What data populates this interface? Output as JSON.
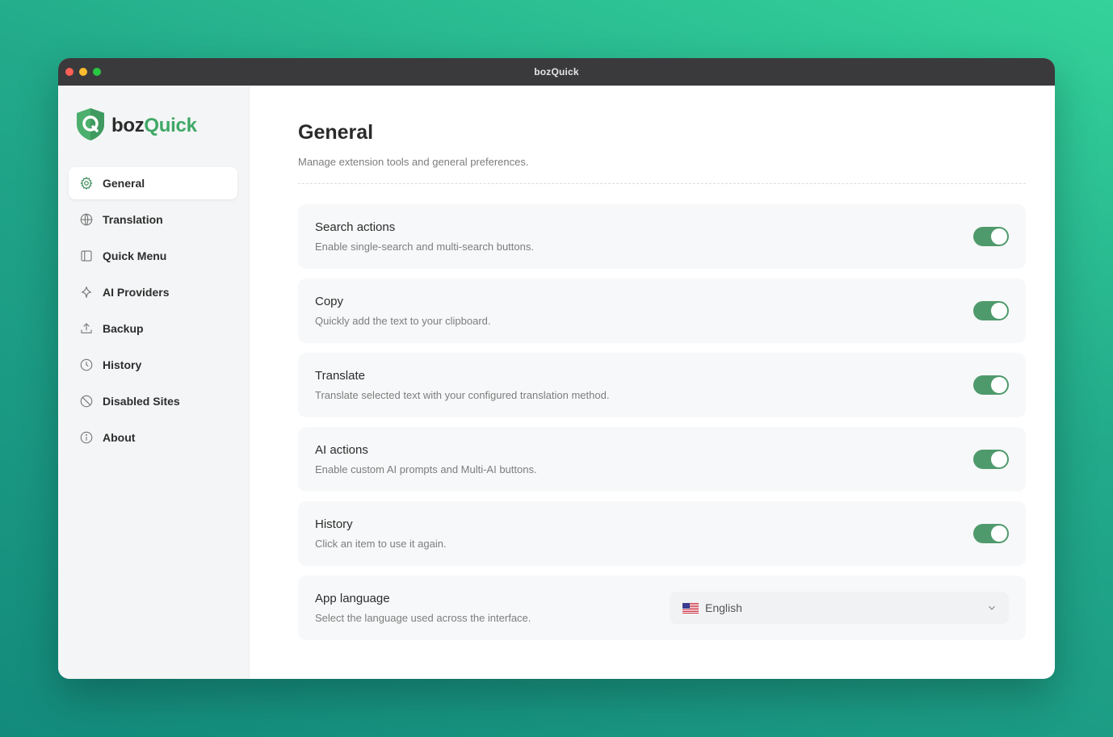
{
  "window": {
    "title": "bozQuick"
  },
  "brand": {
    "part1": "boz",
    "part2": "Quick"
  },
  "sidebar": {
    "items": [
      {
        "label": "General",
        "icon": "gear-icon",
        "active": true
      },
      {
        "label": "Translation",
        "icon": "globe-icon",
        "active": false
      },
      {
        "label": "Quick Menu",
        "icon": "panel-icon",
        "active": false
      },
      {
        "label": "AI Providers",
        "icon": "sparkle-icon",
        "active": false
      },
      {
        "label": "Backup",
        "icon": "upload-icon",
        "active": false
      },
      {
        "label": "History",
        "icon": "clock-icon",
        "active": false
      },
      {
        "label": "Disabled Sites",
        "icon": "ban-icon",
        "active": false
      },
      {
        "label": "About",
        "icon": "info-icon",
        "active": false
      }
    ]
  },
  "main": {
    "title": "General",
    "subtitle": "Manage extension tools and general preferences.",
    "settings": [
      {
        "title": "Search actions",
        "desc": "Enable single-search and multi-search buttons.",
        "enabled": true
      },
      {
        "title": "Copy",
        "desc": "Quickly add the text to your clipboard.",
        "enabled": true
      },
      {
        "title": "Translate",
        "desc": "Translate selected text with your configured translation method.",
        "enabled": true
      },
      {
        "title": "AI actions",
        "desc": "Enable custom AI prompts and Multi-AI buttons.",
        "enabled": true
      },
      {
        "title": "History",
        "desc": "Click an item to use it again.",
        "enabled": true
      }
    ],
    "language": {
      "title": "App language",
      "desc": "Select the language used across the interface.",
      "selected": "English",
      "flag_icon": "us-flag-icon"
    }
  },
  "colors": {
    "accent": "#4f9a6c",
    "brand_green": "#3fa866",
    "background_gradient": [
      "#34d39a",
      "#138a7c"
    ]
  }
}
